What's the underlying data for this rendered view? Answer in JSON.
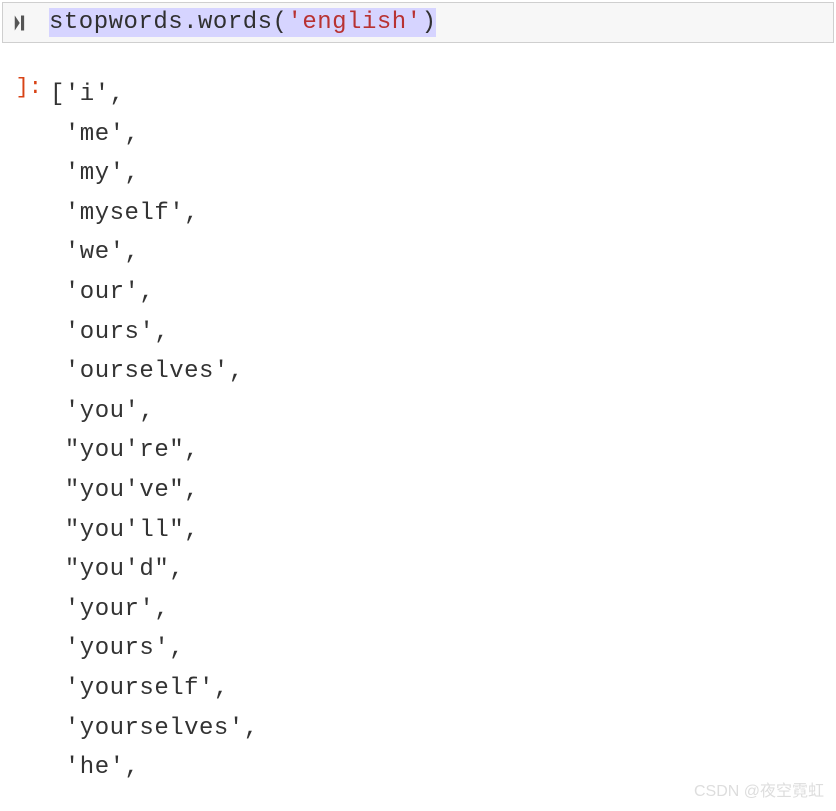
{
  "input": {
    "code_prefix": "stopwords.words(",
    "code_string": "'english'",
    "code_suffix": ")"
  },
  "output": {
    "prompt": "]:",
    "lines": [
      "['i',",
      " 'me',",
      " 'my',",
      " 'myself',",
      " 'we',",
      " 'our',",
      " 'ours',",
      " 'ourselves',",
      " 'you',",
      " \"you're\",",
      " \"you've\",",
      " \"you'll\",",
      " \"you'd\",",
      " 'your',",
      " 'yours',",
      " 'yourself',",
      " 'yourselves',",
      " 'he',"
    ]
  },
  "watermark": "CSDN @夜空霓虹"
}
